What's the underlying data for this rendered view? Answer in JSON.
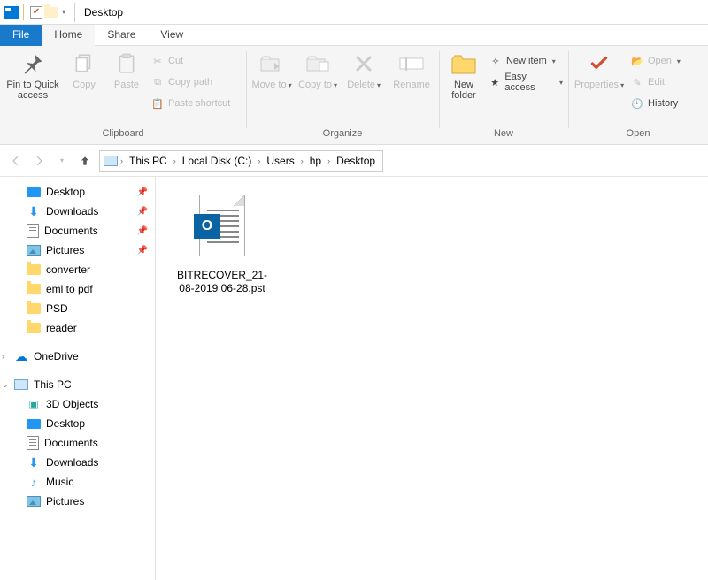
{
  "titlebar": {
    "title": "Desktop"
  },
  "tabs": {
    "file": "File",
    "home": "Home",
    "share": "Share",
    "view": "View"
  },
  "ribbon": {
    "clipboard": {
      "label": "Clipboard",
      "pin": "Pin to Quick access",
      "copy": "Copy",
      "paste": "Paste",
      "cut": "Cut",
      "copy_path": "Copy path",
      "paste_shortcut": "Paste shortcut"
    },
    "organize": {
      "label": "Organize",
      "move_to": "Move to",
      "copy_to": "Copy to",
      "delete": "Delete",
      "rename": "Rename"
    },
    "new": {
      "label": "New",
      "new_folder": "New folder",
      "new_item": "New item",
      "easy_access": "Easy access"
    },
    "open": {
      "label": "Open",
      "properties": "Properties",
      "open": "Open",
      "edit": "Edit",
      "history": "History"
    }
  },
  "breadcrumb": [
    "This PC",
    "Local Disk (C:)",
    "Users",
    "hp",
    "Desktop"
  ],
  "sidebar": {
    "quick": [
      {
        "label": "Desktop",
        "icon": "desktop",
        "pinned": true
      },
      {
        "label": "Downloads",
        "icon": "downloads",
        "pinned": true
      },
      {
        "label": "Documents",
        "icon": "docs",
        "pinned": true
      },
      {
        "label": "Pictures",
        "icon": "pics",
        "pinned": true
      },
      {
        "label": "converter",
        "icon": "folder",
        "pinned": false
      },
      {
        "label": "eml to pdf",
        "icon": "folder",
        "pinned": false
      },
      {
        "label": "PSD",
        "icon": "folder",
        "pinned": false
      },
      {
        "label": "reader",
        "icon": "folder",
        "pinned": false
      }
    ],
    "onedrive": "OneDrive",
    "thispc": {
      "label": "This PC",
      "children": [
        {
          "label": "3D Objects",
          "icon": "threeD"
        },
        {
          "label": "Desktop",
          "icon": "desktop"
        },
        {
          "label": "Documents",
          "icon": "docs"
        },
        {
          "label": "Downloads",
          "icon": "downloads"
        },
        {
          "label": "Music",
          "icon": "music"
        },
        {
          "label": "Pictures",
          "icon": "pics"
        }
      ]
    }
  },
  "files": [
    {
      "name": "BITRECOVER_21-08-2019 06-28.pst"
    }
  ]
}
